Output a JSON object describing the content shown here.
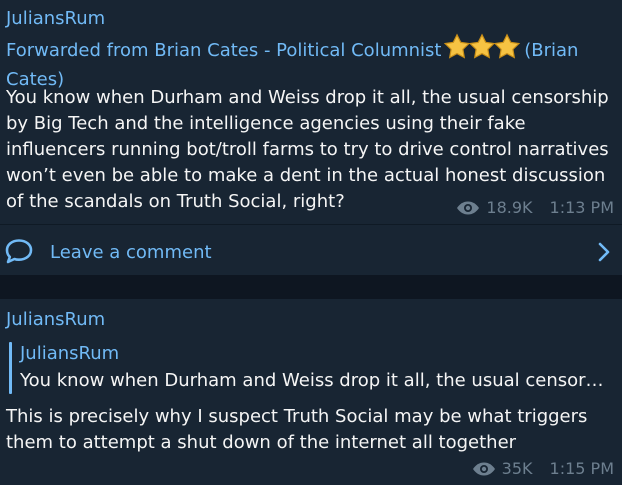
{
  "messages": [
    {
      "author": "JuliansRum",
      "forwarded_prefix": "Forwarded from Brian Cates - Political Columnist",
      "forwarded_suffix": "(Brian Cates)",
      "text": "You know when Durham and Weiss drop it all, the usual censorship\nby Big Tech and the intelligence agencies using their fake\ninfluencers running bot/troll farms to try to drive control narratives\nwon’t even be able to make a dent in the actual honest discussion\nof the scandals on Truth Social, right?",
      "views": "18.9K",
      "time": "1:13 PM",
      "comment_label": "Leave a comment",
      "icons": {
        "stars": "star-icon",
        "views": "eye-icon",
        "comment": "comment-bubble-icon",
        "chevron": "chevron-right-icon"
      },
      "colors": {
        "star": "#f6c343",
        "star_outline": "#c98f17"
      }
    },
    {
      "author": "JuliansRum",
      "reply_to_author": "JuliansRum",
      "reply_to_text": "You know when Durham and Weiss drop it all, the usual censor…",
      "text": "This is precisely why I suspect Truth Social may be what triggers\nthem to attempt a shut down of the internet all together",
      "views": "35K",
      "time": "1:15 PM",
      "icons": {
        "views": "eye-icon"
      }
    }
  ],
  "colors": {
    "background": "#0e1621",
    "card": "#182533",
    "accent": "#71baf6",
    "text": "#f5f5f5",
    "meta": "#6d7f8f"
  }
}
